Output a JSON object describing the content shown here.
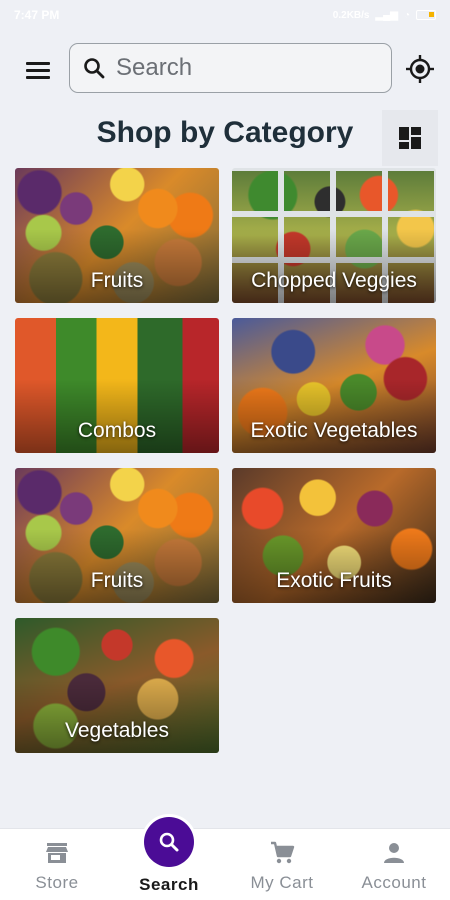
{
  "status_bar": {
    "time": "7:47 PM",
    "info": "0.2KB/s"
  },
  "header": {
    "search": {
      "placeholder": "Search",
      "value": ""
    }
  },
  "page_title": "Shop by Category",
  "categories": [
    {
      "label": "Fruits"
    },
    {
      "label": "Chopped Veggies"
    },
    {
      "label": "Combos"
    },
    {
      "label": "Exotic Vegetables"
    },
    {
      "label": "Fruits"
    },
    {
      "label": "Exotic Fruits"
    },
    {
      "label": "Vegetables"
    }
  ],
  "bottom_nav": {
    "items": [
      {
        "label": "Store",
        "icon": "store-icon"
      },
      {
        "label": "Search",
        "icon": "search-icon",
        "active": true
      },
      {
        "label": "My Cart",
        "icon": "cart-icon"
      },
      {
        "label": "Account",
        "icon": "account-icon"
      }
    ]
  },
  "colors": {
    "accent": "#4b0c96",
    "title": "#1f2f3a",
    "background": "#eef0f5",
    "nav_inactive": "#8a8f96"
  }
}
